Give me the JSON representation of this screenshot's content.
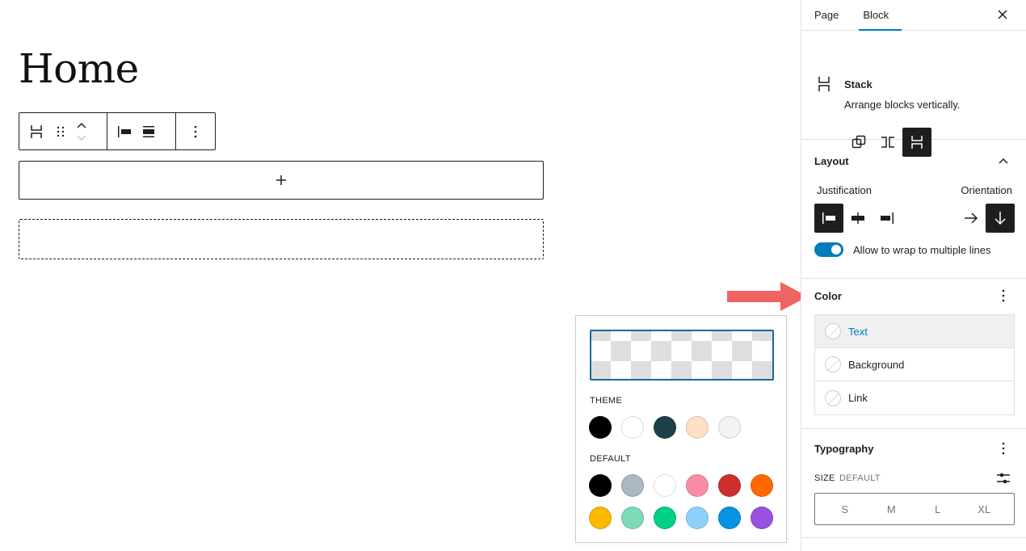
{
  "canvas": {
    "page_title": "Home",
    "appender_label": "+"
  },
  "color_popover": {
    "theme_label": "THEME",
    "default_label": "DEFAULT",
    "theme_colors": [
      {
        "name": "Black",
        "hex": "#000000"
      },
      {
        "name": "White",
        "hex": "#ffffff"
      },
      {
        "name": "Dark Teal",
        "hex": "#1c4148"
      },
      {
        "name": "Peach",
        "hex": "#fde0c6"
      },
      {
        "name": "Light Gray",
        "hex": "#f3f3f3"
      }
    ],
    "default_colors": [
      {
        "name": "Black",
        "hex": "#000000"
      },
      {
        "name": "Cyan bluish gray",
        "hex": "#abb8c3"
      },
      {
        "name": "White",
        "hex": "#ffffff"
      },
      {
        "name": "Pale pink",
        "hex": "#f78da7"
      },
      {
        "name": "Vivid red",
        "hex": "#cf2e2e"
      },
      {
        "name": "Luminous vivid orange",
        "hex": "#ff6900"
      },
      {
        "name": "Luminous vivid amber",
        "hex": "#fcb900"
      },
      {
        "name": "Light green cyan",
        "hex": "#7bdcb5"
      },
      {
        "name": "Vivid green cyan",
        "hex": "#00d084"
      },
      {
        "name": "Pale cyan blue",
        "hex": "#8ed1fc"
      },
      {
        "name": "Vivid cyan blue",
        "hex": "#0693e3"
      },
      {
        "name": "Vivid purple",
        "hex": "#9b51e0"
      }
    ]
  },
  "sidebar": {
    "tabs": [
      {
        "label": "Page",
        "active": false
      },
      {
        "label": "Block",
        "active": true
      }
    ],
    "block_card": {
      "title": "Stack",
      "description": "Arrange blocks vertically."
    },
    "layout": {
      "title": "Layout",
      "justification_label": "Justification",
      "orientation_label": "Orientation",
      "wrap_label": "Allow to wrap to multiple lines",
      "wrap_enabled": true
    },
    "color": {
      "title": "Color",
      "items": [
        {
          "label": "Text",
          "active": true
        },
        {
          "label": "Background",
          "active": false
        },
        {
          "label": "Link",
          "active": false
        }
      ]
    },
    "typography": {
      "title": "Typography",
      "size_label": "SIZE",
      "size_value": "DEFAULT",
      "sizes": [
        "S",
        "M",
        "L",
        "XL"
      ]
    }
  },
  "colors": {
    "accent": "#007cba",
    "annotation_arrow": "#ee6461",
    "dark": "#1e1e1e"
  }
}
